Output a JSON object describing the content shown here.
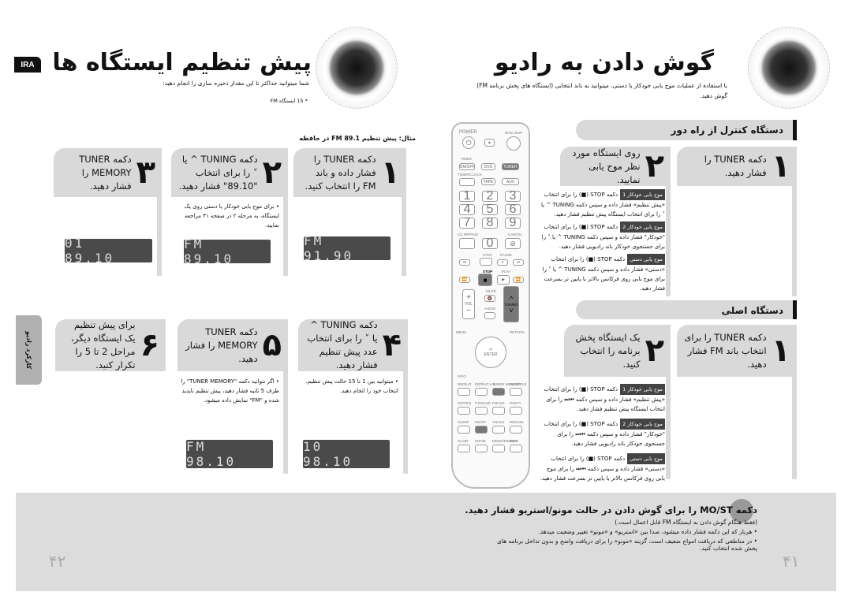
{
  "left_page": {
    "badge": "IRA",
    "title": "پیش تنظیم ایستگاه ها",
    "subtitle": "شما میتوانید حداکثر تا این مقدار ذخیره سازی را انجام دهید:",
    "bullet": "* 15 ایستگاه FM",
    "example": "مثال: پیش تنظیم FM 89.1 در حافظه",
    "steps": [
      {
        "num": "۱",
        "text": "دکمه TUNER را فشار داده و باند FM را انتخاب کنید.",
        "display": "FM 91.90"
      },
      {
        "num": "۲",
        "text": "دکمه TUNING ^ یا ˅ را برای انتخاب \"89.10\" فشار دهید.",
        "note": "• برای موج یابی خودکار یا دستی روی یک ایستگاه، به مرحله ۲ در صفحه ۴۱ مراجعه نمایید.",
        "display": "FM 89.10"
      },
      {
        "num": "۳",
        "text": "دکمه TUNER MEMORY را فشار دهید.",
        "display": "01 89.10"
      },
      {
        "num": "۴",
        "text": "دکمه TUNING ^ یا ˅ را برای انتخاب عدد پیش تنظیم فشار دهید.",
        "note": "• میتوانید بین 1 تا 15 حالت پیش تنظیم، انتخاب خود را انجام دهید.",
        "display": "10 98.10"
      },
      {
        "num": "۵",
        "text": "دکمه TUNER MEMORY را فشار دهید.",
        "note": "• اگر نتوانید دکمه \"TUNER MEMORY\" را ظرف 5 ثانیه فشار دهید، پیش تنظیم ناپدید شده و \"FM\" نمایش داده میشود.",
        "display": "FM 98.10"
      },
      {
        "num": "۶",
        "text": "برای پیش تنظیم یک ایستگاه دیگر، مراحل 2 تا 5 را تکرار کنید."
      }
    ],
    "side_tab": "کارکرد رادیو",
    "page_number": "۴۲"
  },
  "right_page": {
    "title": "گوش دادن به رادیو",
    "subtitle": "با استفاده از عملیات موج یابی خودکار یا دستی، میتوانید به باند انتخابی (ایستگاه های پخش برنامه FM) گوش دهید.",
    "remote_section": {
      "header": "دستگاه کنترل از راه دور",
      "step1": {
        "num": "۱",
        "text": "دکمه TUNER را فشار دهید."
      },
      "step2": {
        "num": "۲",
        "text": "روی ایستگاه مورد نظر موج یابی نمایید."
      },
      "notes": [
        {
          "tag": "موج یابی خودکار 1",
          "text": "دکمه STOP (■) را برای انتخاب «پیش تنظیم» فشار داده و سپس دکمه TUNING ^ یا ˅ را برای انتخاب ایستگاه پیش تنظیم فشار دهید."
        },
        {
          "tag": "موج یابی خودکار 2",
          "text": "دکمه STOP (■) را برای انتخاب \"خودکار\" فشار داده و سپس دکمه TUNING ^ یا ˅ را برای جستجوی خودکار باند رادیویی فشار دهید."
        },
        {
          "tag": "موج یابی دستی",
          "text": "دکمه STOP (■) را برای انتخاب «دستی» فشار داده و سپس دکمه TUNING ^ یا ˅ را برای موج یابی روی فرکانس بالاتر یا پایین تر بسرعت فشار دهید."
        }
      ]
    },
    "main_section": {
      "header": "دستگاه اصلی",
      "step1": {
        "num": "۱",
        "text": "دکمه TUNER را برای انتخاب باند FM فشار دهید."
      },
      "step2": {
        "num": "۲",
        "text": "یک ایستگاه پخش برنامه را انتخاب کنید."
      },
      "notes": [
        {
          "tag": "موج یابی خودکار 1",
          "text": "دکمه STOP (■) را برای انتخاب «پیش تنظیم» فشار داده و سپس دکمه ⏮⏭ را برای انتخاب ایستگاه پیش تنظیم فشار دهید."
        },
        {
          "tag": "موج یابی خودکار 2",
          "text": "دکمه STOP (■) را برای انتخاب \"خودکار\" فشار داده و سپس دکمه ⏮⏭ را برای جستجوی خودکار باند رادیویی فشار دهید."
        },
        {
          "tag": "موج یابی دستی",
          "text": "دکمه STOP (■) را برای انتخاب «دستی» فشار داده و سپس دکمه ⏮⏭ را برای موج یابی روی فرکانس بالاتر یا پایین تر بسرعت فشار دهید."
        }
      ]
    },
    "remote": {
      "power": "POWER",
      "disc_skip": "DISC SKIP",
      "timer": "TIMER",
      "onoff": "ON/OFF",
      "timerclock": "TIMER/CLOCK",
      "dvd": "DVD",
      "tuner": "TUNER",
      "tape": "TAPE",
      "aux": "AUX",
      "digits": [
        "1",
        "2",
        "3",
        "4",
        "5",
        "6",
        "7",
        "8",
        "9",
        "0"
      ],
      "cd_ripping": "CD RIPPING",
      "cancel": "CANCEL",
      "step": "STEP",
      "pause": "PAUSE",
      "stop": "STOP",
      "play": "PLAY",
      "mute": "MUTE",
      "vol": "VOL",
      "audio": "AUDIO",
      "tuning": "TUNING",
      "menu": "MENU",
      "return": "RETURN",
      "enter": "ENTER",
      "info": "INFO",
      "repeat": "REPEAT",
      "repeat_ab": "REPEAT A-B",
      "tuner_memory": "TUNER MEMORY",
      "subtitle": "SUBTITLE",
      "dsp_eq": "DSP/EQ",
      "psound": "P.SOUND",
      "pbass": "P.BASS",
      "party": "PARTY",
      "sleep": "SLEEP",
      "most": "MO/ST",
      "angle": "ANGLE",
      "remain": "REMAIN",
      "slow": "SLOW",
      "zoom": "ZOOM",
      "demo": "DEMO/DIMMER",
      "rec": "REC"
    },
    "bottom": {
      "heading": "دکمه MO/ST را برای گوش دادن در حالت مونو/استریو فشار دهید.",
      "sub": "(فقط هنگام گوش دادن به ایستگاه FM قابل اعمال است.)",
      "bullets": [
        "• هربار که این دکمه فشار داده میشود، صدا بین «استریو» و «مونو» تغییر وضعیت میدهد.",
        "• در مناطقی که دریافت امواج ضعیف است، گزینه «مونو» را برای دریافت واضح و بدون تداخل برنامه های پخش شده انتخاب کنید."
      ]
    },
    "page_number": "۴۱"
  }
}
